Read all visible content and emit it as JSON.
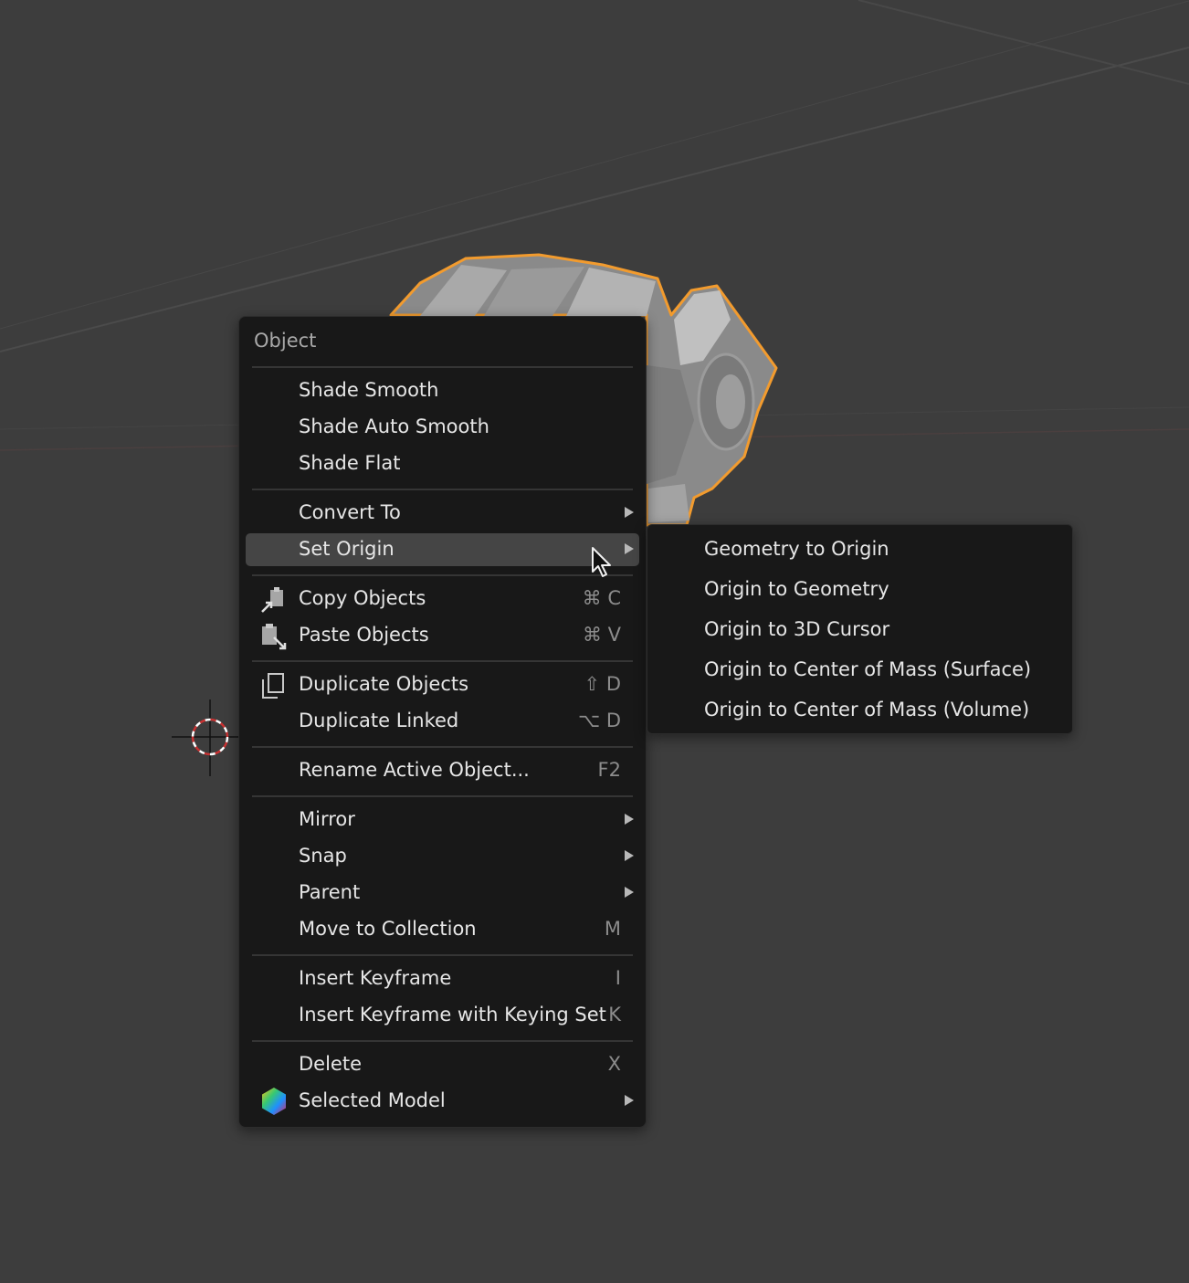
{
  "menu": {
    "title": "Object",
    "groups": [
      [
        {
          "label": "Shade Smooth"
        },
        {
          "label": "Shade Auto Smooth"
        },
        {
          "label": "Shade Flat"
        }
      ],
      [
        {
          "label": "Convert To",
          "submenu": true
        },
        {
          "label": "Set Origin",
          "submenu": true,
          "active": true
        }
      ],
      [
        {
          "label": "Copy Objects",
          "shortcut": "⌘ C",
          "icon": "copy-icon"
        },
        {
          "label": "Paste Objects",
          "shortcut": "⌘ V",
          "icon": "paste-icon"
        }
      ],
      [
        {
          "label": "Duplicate Objects",
          "shortcut": "⇧ D",
          "icon": "duplicate-icon"
        },
        {
          "label": "Duplicate Linked",
          "shortcut": "⌥ D"
        }
      ],
      [
        {
          "label": "Rename Active Object...",
          "shortcut": "F2"
        }
      ],
      [
        {
          "label": "Mirror",
          "submenu": true
        },
        {
          "label": "Snap",
          "submenu": true
        },
        {
          "label": "Parent",
          "submenu": true
        },
        {
          "label": "Move to Collection",
          "shortcut": "M"
        }
      ],
      [
        {
          "label": "Insert Keyframe",
          "shortcut": "I"
        },
        {
          "label": "Insert Keyframe with Keying Set",
          "shortcut": "K"
        }
      ],
      [
        {
          "label": "Delete",
          "shortcut": "X"
        },
        {
          "label": "Selected Model",
          "submenu": true,
          "icon": "model-icon"
        }
      ]
    ]
  },
  "submenu": {
    "items": [
      {
        "label": "Geometry to Origin"
      },
      {
        "label": "Origin to Geometry"
      },
      {
        "label": "Origin to 3D Cursor"
      },
      {
        "label": "Origin to Center of Mass (Surface)"
      },
      {
        "label": "Origin to Center of Mass (Volume)"
      }
    ]
  },
  "colors": {
    "background": "#3d3d3d",
    "menu_bg": "#181818",
    "highlight": "#454545",
    "selection_outline": "#f29b2e",
    "text": "#e6e6e6",
    "shortcut_text": "#8c8c8c"
  }
}
